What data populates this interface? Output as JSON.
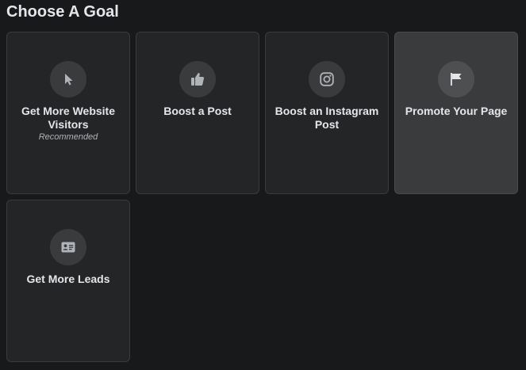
{
  "heading": "Choose A Goal",
  "goals": [
    {
      "title": "Get More Website Visitors",
      "subtitle": "Recommended",
      "icon": "cursor-icon"
    },
    {
      "title": "Boost a Post",
      "icon": "thumbs-up-icon"
    },
    {
      "title": "Boost an Instagram Post",
      "icon": "instagram-icon"
    },
    {
      "title": "Promote Your Page",
      "icon": "flag-icon",
      "selected": true
    },
    {
      "title": "Get More Leads",
      "icon": "contact-card-icon"
    }
  ],
  "colors": {
    "background": "#18191a",
    "card": "#242526",
    "card_selected": "#3a3b3c",
    "icon": "#b0b3b8",
    "text": "#e4e6eb"
  }
}
